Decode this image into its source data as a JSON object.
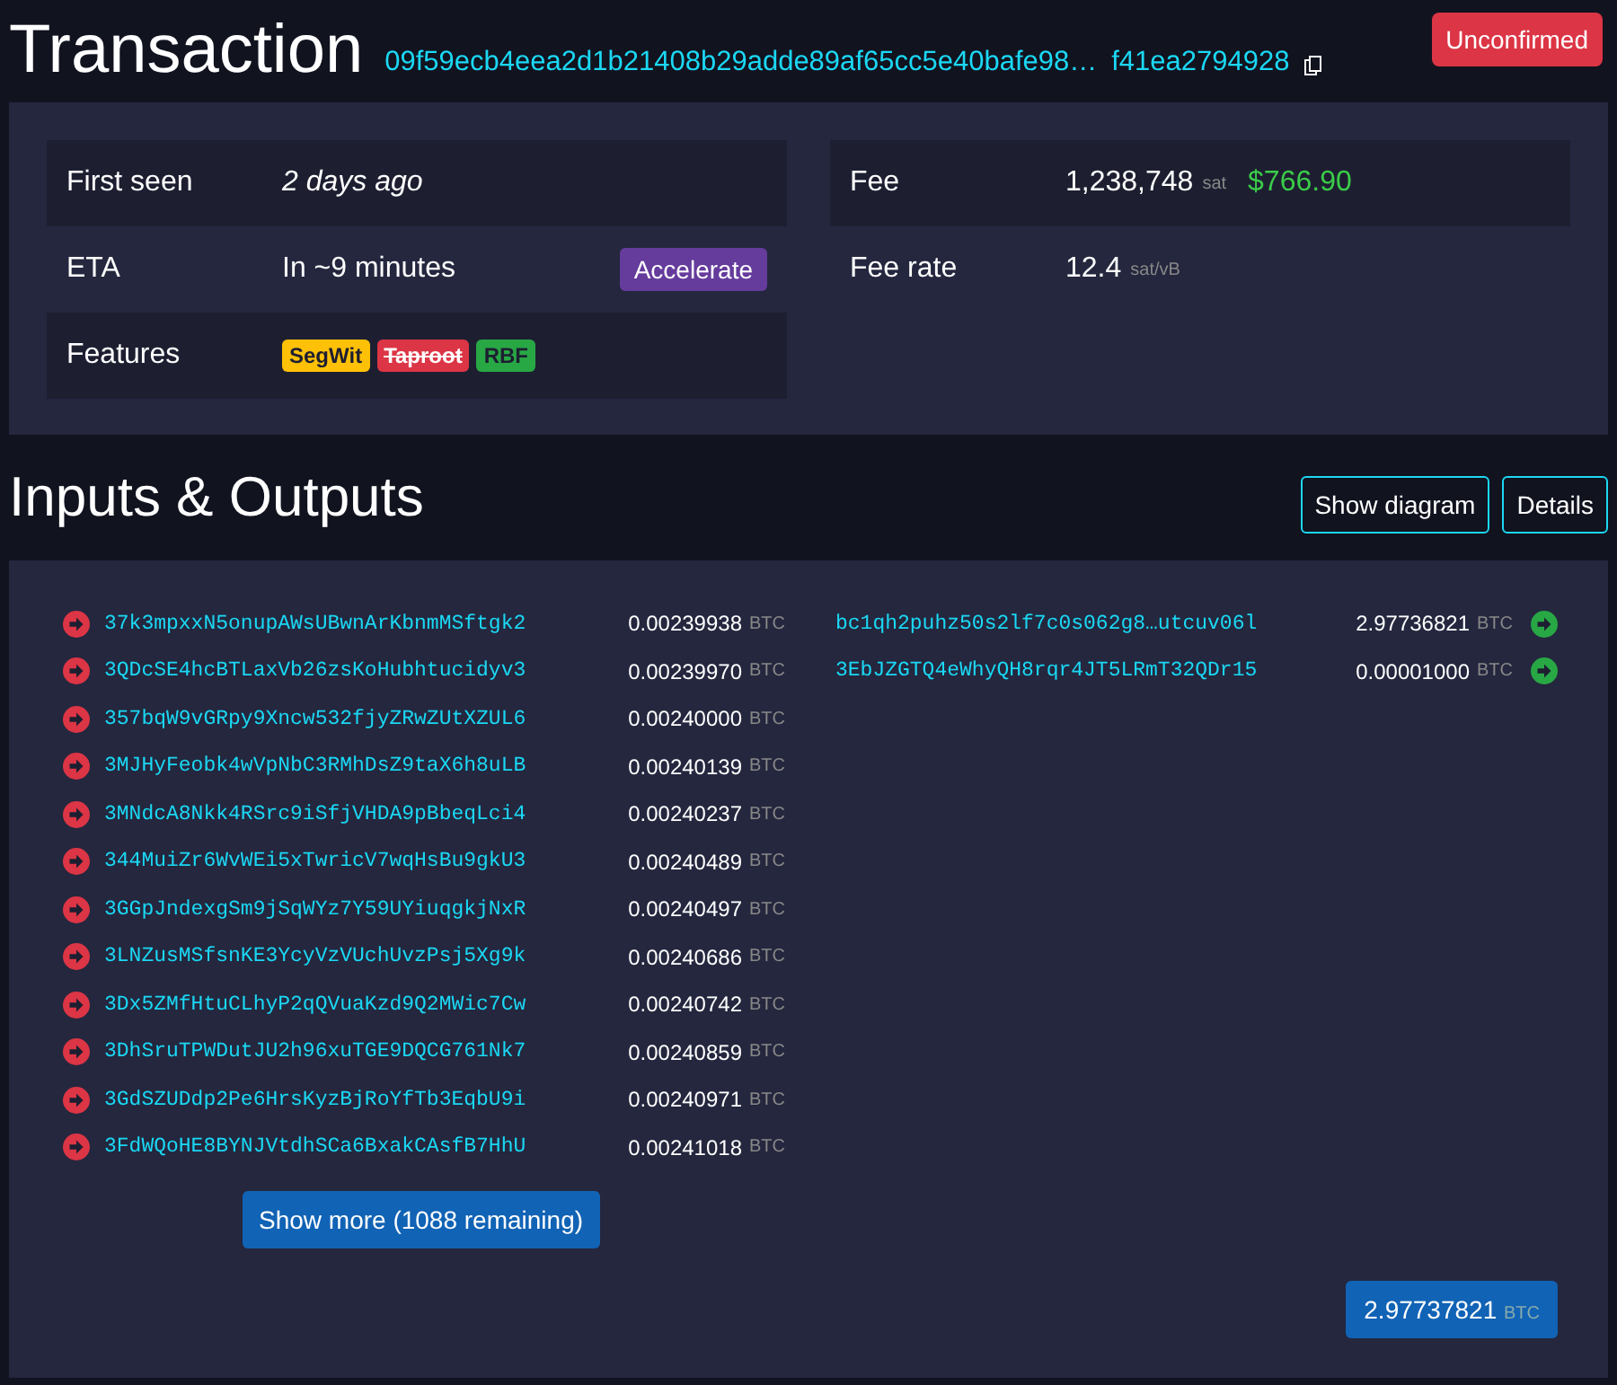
{
  "header": {
    "title": "Transaction",
    "txid_start": "09f59ecb4eea2d1b21408b29adde89af65cc5e40bafe98…",
    "txid_end": "f41ea2794928",
    "status": "Unconfirmed"
  },
  "details_left": [
    {
      "kind": "text",
      "label": "First seen",
      "value": "2 days ago",
      "italic": true
    },
    {
      "kind": "action",
      "label": "ETA",
      "value": "In ~9 minutes",
      "button": "Accelerate"
    },
    {
      "kind": "features",
      "label": "Features",
      "features": [
        {
          "name": "SegWit",
          "color": "#ffc107",
          "struck": false
        },
        {
          "name": "Taproot",
          "color": "#dc3545",
          "struck": true
        },
        {
          "name": "RBF",
          "color": "#28a745",
          "struck": false
        }
      ]
    }
  ],
  "details_right": [
    {
      "label": "Fee",
      "value": "1,238,748",
      "unit": "sat",
      "fiat": "$766.90"
    },
    {
      "label": "Fee rate",
      "value": "12.4",
      "unit": "sat/vB"
    }
  ],
  "io": {
    "title": "Inputs & Outputs",
    "buttons": [
      "Show diagram",
      "Details"
    ],
    "inputs": [
      {
        "address": "37k3mpxxN5onupAWsUBwnArKbnmMSftgk2",
        "amount": "0.00239938",
        "unit": "BTC"
      },
      {
        "address": "3QDcSE4hcBTLaxVb26zsKoHubhtucidyv3",
        "amount": "0.00239970",
        "unit": "BTC"
      },
      {
        "address": "357bqW9vGRpy9Xncw532fjyZRwZUtXZUL6",
        "amount": "0.00240000",
        "unit": "BTC"
      },
      {
        "address": "3MJHyFeobk4wVpNbC3RMhDsZ9taX6h8uLB",
        "amount": "0.00240139",
        "unit": "BTC"
      },
      {
        "address": "3MNdcA8Nkk4RSrc9iSfjVHDA9pBbeqLci4",
        "amount": "0.00240237",
        "unit": "BTC"
      },
      {
        "address": "344MuiZr6WvWEi5xTwricV7wqHsBu9gkU3",
        "amount": "0.00240489",
        "unit": "BTC"
      },
      {
        "address": "3GGpJndexgSm9jSqWYz7Y59UYiuqgkjNxR",
        "amount": "0.00240497",
        "unit": "BTC"
      },
      {
        "address": "3LNZusMSfsnKE3YcyVzVUchUvzPsj5Xg9k",
        "amount": "0.00240686",
        "unit": "BTC"
      },
      {
        "address": "3Dx5ZMfHtuCLhyP2qQVuaKzd9Q2MWic7Cw",
        "amount": "0.00240742",
        "unit": "BTC"
      },
      {
        "address": "3DhSruTPWDutJU2h96xuTGE9DQCG761Nk7",
        "amount": "0.00240859",
        "unit": "BTC"
      },
      {
        "address": "3GdSZUDdp2Pe6HrsKyzBjRoYfTb3EqbU9i",
        "amount": "0.00240971",
        "unit": "BTC"
      },
      {
        "address": "3FdWQoHE8BYNJVtdhSCa6BxakCAsfB7HhU",
        "amount": "0.00241018",
        "unit": "BTC"
      }
    ],
    "show_more": "Show more (1088 remaining)",
    "outputs": [
      {
        "address": "bc1qh2puhz50s2lf7c0s062g8…utcuv06l",
        "amount": "2.97736821",
        "unit": "BTC"
      },
      {
        "address": "3EbJZGTQ4eWhyQH8rqr4JT5LRmT32QDr15",
        "amount": "0.00001000",
        "unit": "BTC"
      }
    ],
    "total": {
      "amount": "2.97737821",
      "unit": "BTC"
    }
  }
}
